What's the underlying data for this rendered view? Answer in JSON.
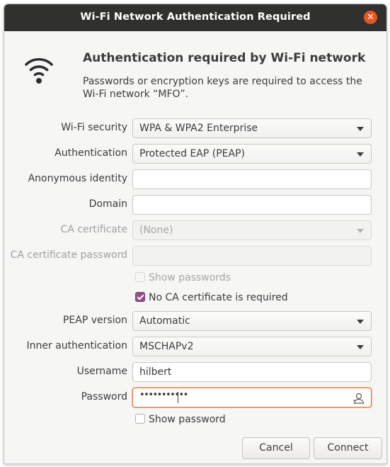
{
  "window": {
    "title": "Wi-Fi Network Authentication Required",
    "close_icon": "close-icon",
    "close_glyph": "✕"
  },
  "header": {
    "icon": "wifi-icon",
    "heading": "Authentication required by Wi-Fi network",
    "message": "Passwords or encryption keys are required to access the Wi-Fi network “MFO”."
  },
  "form": {
    "wifi_security": {
      "label": "Wi-Fi security",
      "value": "WPA & WPA2 Enterprise"
    },
    "authentication": {
      "label": "Authentication",
      "value": "Protected EAP (PEAP)"
    },
    "anonymous_identity": {
      "label": "Anonymous identity",
      "value": ""
    },
    "domain": {
      "label": "Domain",
      "value": ""
    },
    "ca_certificate": {
      "label": "CA certificate",
      "value": "(None)",
      "enabled": false
    },
    "ca_certificate_password": {
      "label": "CA certificate password",
      "value": "",
      "enabled": false
    },
    "show_passwords": {
      "label": "Show passwords",
      "checked": false,
      "enabled": false
    },
    "no_ca_required": {
      "label": "No CA certificate is required",
      "checked": true
    },
    "peap_version": {
      "label": "PEAP version",
      "value": "Automatic"
    },
    "inner_authentication": {
      "label": "Inner authentication",
      "value": "MSCHAPv2"
    },
    "username": {
      "label": "Username",
      "value": "hilbert"
    },
    "password": {
      "label": "Password",
      "masked_value": "•••••••••••",
      "icon": "user-password-icon"
    },
    "show_password": {
      "label": "Show password",
      "checked": false
    }
  },
  "buttons": {
    "cancel": "Cancel",
    "connect": "Connect"
  },
  "colors": {
    "titlebar": "#30302e",
    "close": "#e9541f",
    "checkbox_accent": "#924d8b",
    "focus_border": "#e9834e"
  }
}
